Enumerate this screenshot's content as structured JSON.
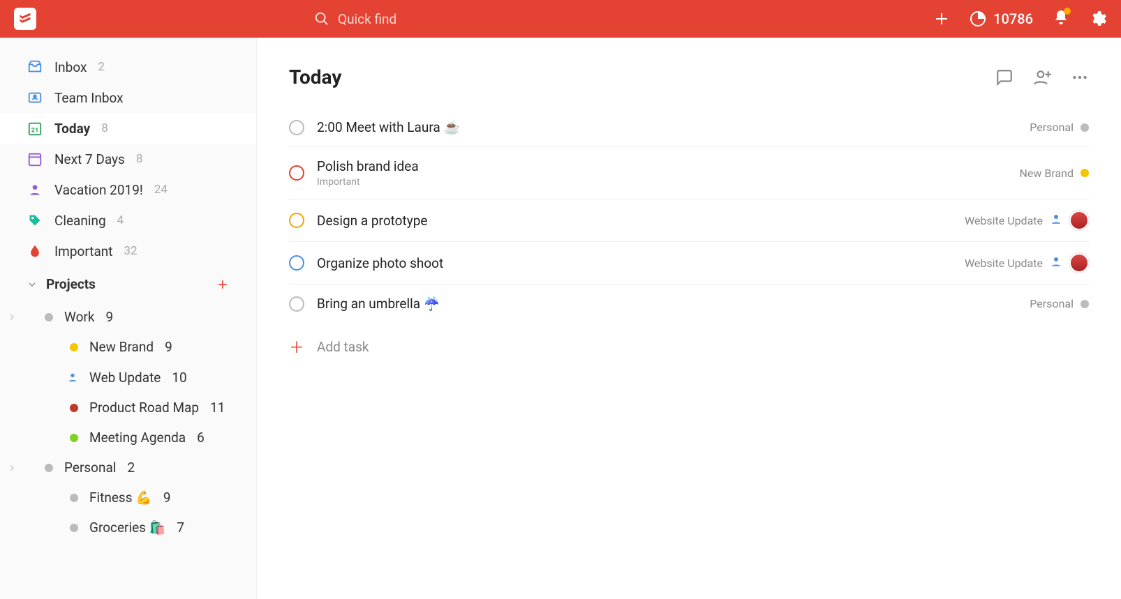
{
  "topbar": {
    "search_placeholder": "Quick find",
    "karma_points": "10786"
  },
  "sidebar": {
    "items": [
      {
        "label": "Inbox",
        "count": "2"
      },
      {
        "label": "Team Inbox",
        "count": ""
      },
      {
        "label": "Today",
        "count": "8"
      },
      {
        "label": "Next 7 Days",
        "count": "8"
      },
      {
        "label": "Vacation 2019!",
        "count": "24"
      },
      {
        "label": "Cleaning",
        "count": "4"
      },
      {
        "label": "Important",
        "count": "32"
      }
    ],
    "projects_header": "Projects",
    "projects": [
      {
        "label": "Work",
        "count": "9"
      },
      {
        "label": "New Brand",
        "count": "9"
      },
      {
        "label": "Web Update",
        "count": "10"
      },
      {
        "label": "Product Road Map",
        "count": "11"
      },
      {
        "label": "Meeting Agenda",
        "count": "6"
      },
      {
        "label": "Personal",
        "count": "2"
      },
      {
        "label": "Fitness 💪",
        "count": "9"
      },
      {
        "label": "Groceries 🛍️",
        "count": "7"
      }
    ]
  },
  "main": {
    "title": "Today",
    "tasks": [
      {
        "title": "2:00 Meet with Laura ☕",
        "sub": "",
        "project": "Personal",
        "dot": "#bbb",
        "ring": "#bbb",
        "assignee": false
      },
      {
        "title": "Polish brand idea",
        "sub": "Important",
        "project": "New Brand",
        "dot": "#f3c600",
        "ring": "#E44232",
        "assignee": false
      },
      {
        "title": "Design a prototype",
        "sub": "",
        "project": "Website Update",
        "dot": "",
        "ring": "#f0a800",
        "assignee": true
      },
      {
        "title": "Organize photo shoot",
        "sub": "",
        "project": "Website Update",
        "dot": "",
        "ring": "#4a90e2",
        "assignee": true
      },
      {
        "title": "Bring an umbrella ☔",
        "sub": "",
        "project": "Personal",
        "dot": "#bbb",
        "ring": "#bbb",
        "assignee": false
      }
    ],
    "add_task_label": "Add task"
  }
}
